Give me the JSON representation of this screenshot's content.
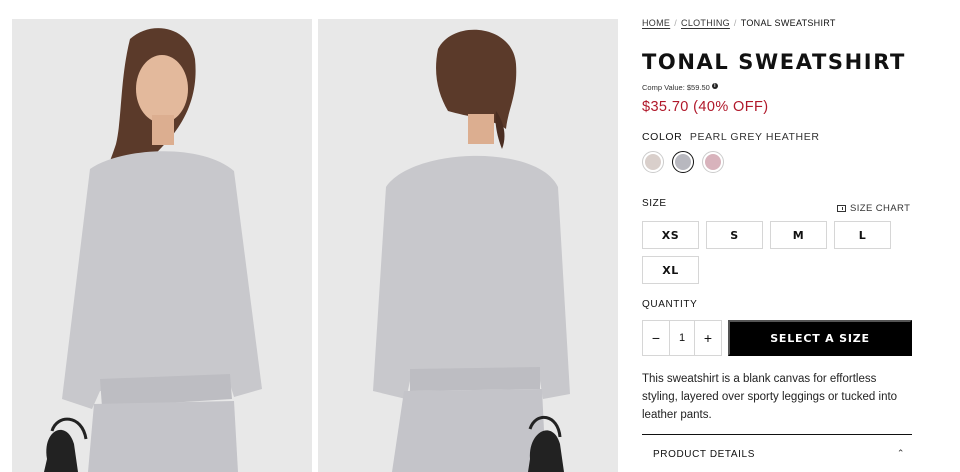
{
  "breadcrumb": {
    "home": "HOME",
    "clothing": "CLOTHING",
    "current": "TONAL SWEATSHIRT",
    "separator": "/"
  },
  "product": {
    "title": "TONAL SWEATSHIRT",
    "comp_value": "Comp Value: $59.50",
    "info_glyph": "i",
    "price": "$35.70 (40% OFF)",
    "price_color": "#b0182a"
  },
  "color": {
    "label": "COLOR",
    "selected_name": "PEARL GREY HEATHER",
    "swatches": [
      {
        "name": "blush",
        "hex": "#d9cfcb"
      },
      {
        "name": "pearl-grey-heather",
        "hex": "#b8b8bf",
        "selected": true
      },
      {
        "name": "mauve",
        "hex": "#d8b3bc"
      }
    ]
  },
  "size": {
    "label": "SIZE",
    "size_chart": "SIZE CHART",
    "options": [
      "XS",
      "S",
      "M",
      "L",
      "XL"
    ]
  },
  "quantity": {
    "label": "QUANTITY",
    "minus": "−",
    "value": "1",
    "plus": "+"
  },
  "cta": {
    "label": "SELECT A SIZE"
  },
  "description": "This sweatshirt is a blank canvas for effortless styling, layered over sporty leggings or tucked into leather pants.",
  "accordion": {
    "product_details": "PRODUCT DETAILS",
    "chevron": "⌃"
  },
  "icons": [
    "info-icon",
    "ruler-icon",
    "chevron-up-icon"
  ]
}
